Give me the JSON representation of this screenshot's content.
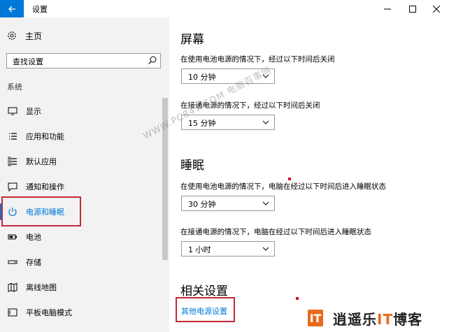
{
  "window": {
    "title": "设置",
    "back_icon": "back-arrow-icon",
    "accent": "#0078d7"
  },
  "sidebar": {
    "home_label": "主页",
    "search_placeholder": "查找设置",
    "section_label": "系统",
    "items": [
      {
        "label": "显示",
        "icon": "display-icon"
      },
      {
        "label": "应用和功能",
        "icon": "apps-list-icon"
      },
      {
        "label": "默认应用",
        "icon": "default-apps-icon"
      },
      {
        "label": "通知和操作",
        "icon": "notification-icon"
      },
      {
        "label": "电源和睡眠",
        "icon": "power-icon",
        "active": true
      },
      {
        "label": "电池",
        "icon": "battery-icon"
      },
      {
        "label": "存储",
        "icon": "storage-icon"
      },
      {
        "label": "离线地图",
        "icon": "map-icon"
      },
      {
        "label": "平板电脑模式",
        "icon": "tablet-icon"
      }
    ]
  },
  "main": {
    "screen": {
      "heading": "屏幕",
      "battery_desc": "在使用电池电源的情况下，经过以下时间后关闭",
      "battery_value": "10 分钟",
      "plugged_desc": "在接通电源的情况下，经过以下时间后关闭",
      "plugged_value": "15 分钟"
    },
    "sleep": {
      "heading": "睡眠",
      "battery_desc": "在使用电池电源的情况下，电脑在经过以下时间后进入睡眠状态",
      "battery_value": "30 分钟",
      "plugged_desc": "在接通电源的情况下，电脑在经过以下时间后进入睡眠状态",
      "plugged_value": "1 小时"
    },
    "related": {
      "heading": "相关设置",
      "link": "其他电源设置"
    }
  },
  "overlay": {
    "watermark": "WWW.PC841.COM 电脑百事网",
    "logo_text_a": "逍遥乐",
    "logo_text_it": "IT",
    "logo_text_b": "博客"
  }
}
